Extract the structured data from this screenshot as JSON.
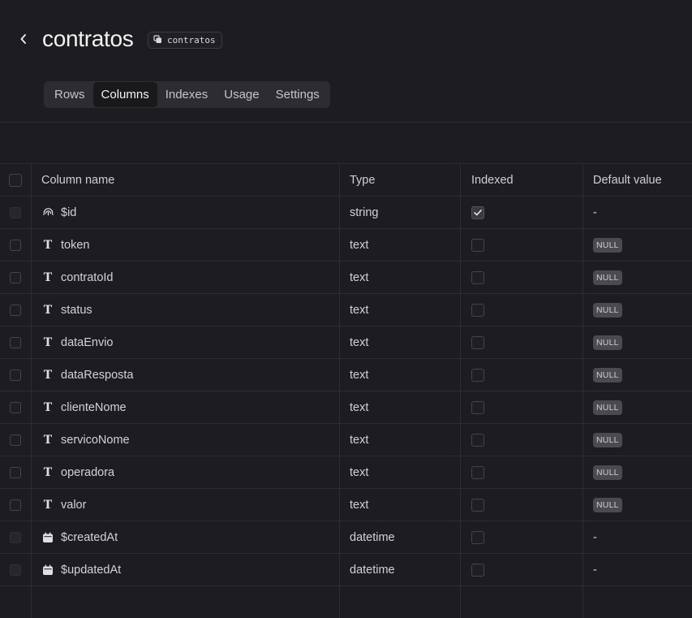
{
  "header": {
    "title": "contratos",
    "id_badge": "contratos",
    "back_icon": "chevron-left-icon",
    "copy_icon": "copy-icon"
  },
  "tabs": [
    {
      "label": "Rows",
      "active": false
    },
    {
      "label": "Columns",
      "active": true
    },
    {
      "label": "Indexes",
      "active": false
    },
    {
      "label": "Usage",
      "active": false
    },
    {
      "label": "Settings",
      "active": false
    }
  ],
  "table": {
    "headers": {
      "name": "Column name",
      "type": "Type",
      "indexed": "Indexed",
      "default": "Default value"
    },
    "rows": [
      {
        "name": "$id",
        "icon": "fingerprint-icon",
        "type": "string",
        "indexed": true,
        "default": "-",
        "system": true
      },
      {
        "name": "token",
        "icon": "text-icon",
        "type": "text",
        "indexed": false,
        "default": "NULL",
        "system": false
      },
      {
        "name": "contratoId",
        "icon": "text-icon",
        "type": "text",
        "indexed": false,
        "default": "NULL",
        "system": false
      },
      {
        "name": "status",
        "icon": "text-icon",
        "type": "text",
        "indexed": false,
        "default": "NULL",
        "system": false
      },
      {
        "name": "dataEnvio",
        "icon": "text-icon",
        "type": "text",
        "indexed": false,
        "default": "NULL",
        "system": false
      },
      {
        "name": "dataResposta",
        "icon": "text-icon",
        "type": "text",
        "indexed": false,
        "default": "NULL",
        "system": false
      },
      {
        "name": "clienteNome",
        "icon": "text-icon",
        "type": "text",
        "indexed": false,
        "default": "NULL",
        "system": false
      },
      {
        "name": "servicoNome",
        "icon": "text-icon",
        "type": "text",
        "indexed": false,
        "default": "NULL",
        "system": false
      },
      {
        "name": "operadora",
        "icon": "text-icon",
        "type": "text",
        "indexed": false,
        "default": "NULL",
        "system": false
      },
      {
        "name": "valor",
        "icon": "text-icon",
        "type": "text",
        "indexed": false,
        "default": "NULL",
        "system": false
      },
      {
        "name": "$createdAt",
        "icon": "calendar-icon",
        "type": "datetime",
        "indexed": false,
        "default": "-",
        "system": true
      },
      {
        "name": "$updatedAt",
        "icon": "calendar-icon",
        "type": "datetime",
        "indexed": false,
        "default": "-",
        "system": true
      }
    ]
  },
  "colors": {
    "background": "#1d1d21",
    "border": "#2c2c31",
    "null_badge": "#4a4a50"
  }
}
